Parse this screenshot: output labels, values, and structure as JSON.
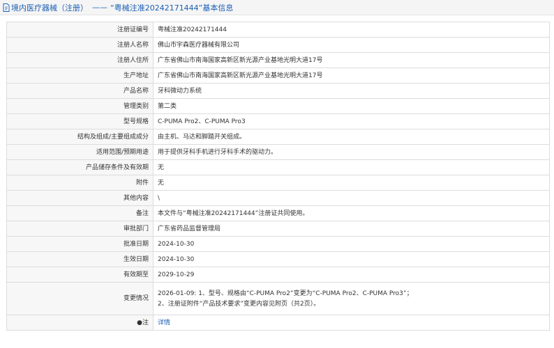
{
  "header": {
    "section": "境内医疗器械（注册）",
    "separator": "——",
    "title": "“粤械注准20242171444”基本信息"
  },
  "rows": [
    {
      "label": "注册证编号",
      "value": "粤械注准20242171444"
    },
    {
      "label": "注册人名称",
      "value": "佛山市宇森医疗器械有限公司"
    },
    {
      "label": "注册人住所",
      "value": "广东省佛山市南海国家高新区新光源产业基地光明大道17号"
    },
    {
      "label": "生产地址",
      "value": "广东省佛山市南海国家高新区新光源产业基地光明大道17号"
    },
    {
      "label": "产品名称",
      "value": "牙科微动力系统"
    },
    {
      "label": "管理类别",
      "value": "第二类"
    },
    {
      "label": "型号规格",
      "value": "C-PUMA Pro2、C-PUMA Pro3"
    },
    {
      "label": "结构及组成/主要组成成分",
      "value": "由主机、马达和脚踏开关组成。"
    },
    {
      "label": "适用范围/预期用途",
      "value": "用于提供牙科手机进行牙科手术的驱动力。"
    },
    {
      "label": "产品储存条件及有效期",
      "value": "无"
    },
    {
      "label": "附件",
      "value": "无"
    },
    {
      "label": "其他内容",
      "value": "\\"
    },
    {
      "label": "备注",
      "value": "本文件与“粤械注准20242171444”注册证共同使用。"
    },
    {
      "label": "审批部门",
      "value": "广东省药品监督管理局"
    },
    {
      "label": "批准日期",
      "value": "2024-10-30"
    },
    {
      "label": "生效日期",
      "value": "2024-10-30"
    },
    {
      "label": "有效期至",
      "value": "2029-10-29"
    }
  ],
  "change": {
    "label": "变更情况",
    "line1": "2026-01-09: 1、型号、规格由“C-PUMA Pro2”变更为“C-PUMA Pro2、C-PUMA Pro3”；",
    "line2": "2、注册证附件“产品技术要求”变更内容见附页（共2页）。"
  },
  "note": {
    "label": "注",
    "marker": "●",
    "link": "详情"
  },
  "colors": {
    "link": "#1a5fb4",
    "label_bg": "#f7f7f7",
    "border": "#dcdcdc"
  }
}
